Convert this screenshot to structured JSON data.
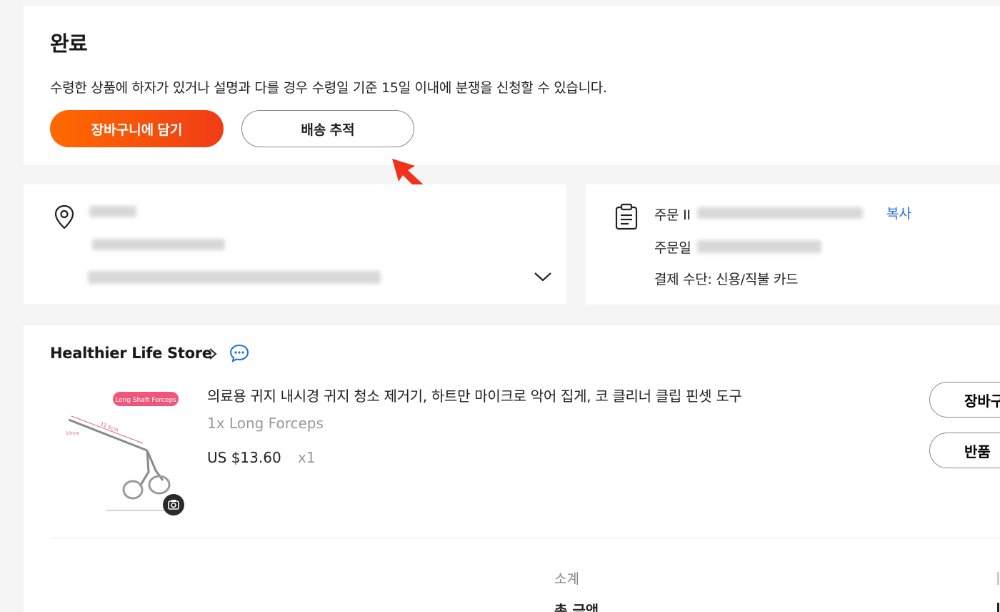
{
  "status": {
    "title": "완료",
    "description": "수령한 상품에 하자가 있거나 설명과 다를 경우 수령일 기준 15일 이내에 분쟁을 신청할 수 있습니다.",
    "add_to_cart_label": "장바구니에 담기",
    "track_shipping_label": "배송 추적"
  },
  "order": {
    "order_id_label": "주문 II",
    "order_date_label": "주문일",
    "payment_line": "결제 수단: 신용/직불 카드",
    "copy_label": "복사"
  },
  "store": {
    "name": "Healthier Life Store"
  },
  "product": {
    "image_tag": "Long Shaft Forceps",
    "image_dimension": "11.5cm",
    "image_small_dimension": "10mm",
    "title": "의료용 귀지 내시경 귀지 청소 제거기, 하트만 마이크로 악어 집게, 코 클리너 클립 핀셋 도구",
    "variant": "1x Long Forceps",
    "price": "US $13.60",
    "quantity": "x1",
    "side_cart_label": "장바구니",
    "side_return_label": "반품"
  },
  "summary": {
    "subtotal_label": "소계",
    "total_label": "총 금액"
  },
  "colors": {
    "accent_orange": "#ff6a00",
    "link_blue": "#1f6fe0",
    "annotation_red": "#f0321c"
  },
  "icons": [
    "location-pin-icon",
    "chevron-down-icon",
    "clipboard-icon",
    "chevron-right-icon",
    "chat-bubble-icon",
    "camera-icon",
    "pointer-arrow"
  ]
}
